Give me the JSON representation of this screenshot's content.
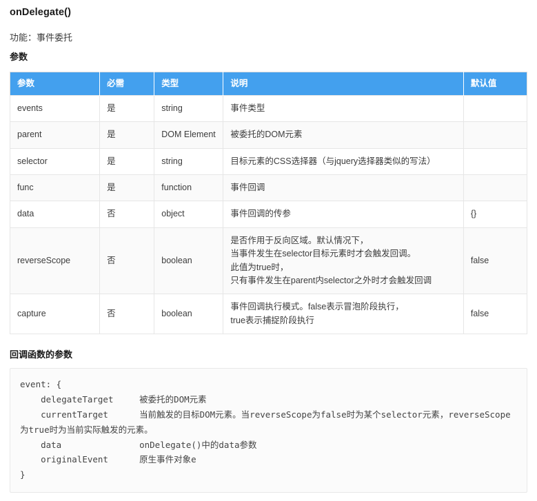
{
  "doc": {
    "title": "onDelegate()",
    "function_line": "功能：事件委托",
    "params_label": "参数",
    "callback_label": "回调函数的参数"
  },
  "table": {
    "headers": [
      "参数",
      "必需",
      "类型",
      "说明",
      "默认值"
    ],
    "rows": [
      {
        "param": "events",
        "required": "是",
        "type": "string",
        "description": "事件类型",
        "default": ""
      },
      {
        "param": "parent",
        "required": "是",
        "type": "DOM Element",
        "description": "被委托的DOM元素",
        "default": ""
      },
      {
        "param": "selector",
        "required": "是",
        "type": "string",
        "description": "目标元素的CSS选择器（与jquery选择器类似的写法）",
        "default": ""
      },
      {
        "param": "func",
        "required": "是",
        "type": "function",
        "description": "事件回调",
        "default": ""
      },
      {
        "param": "data",
        "required": "否",
        "type": "object",
        "description": "事件回调的传参",
        "default": "{}"
      },
      {
        "param": "reverseScope",
        "required": "否",
        "type": "boolean",
        "description": "是否作用于反向区域。默认情况下，\n当事件发生在selector目标元素时才会触发回调。\n此值为true时，\n只有事件发生在parent内selector之外时才会触发回调",
        "default": "false"
      },
      {
        "param": "capture",
        "required": "否",
        "type": "boolean",
        "description": "事件回调执行模式。false表示冒泡阶段执行，\ntrue表示捕捉阶段执行",
        "default": "false"
      }
    ]
  },
  "code": {
    "content": "event: {\n    delegateTarget     被委托的DOM元素\n    currentTarget      当前触发的目标DOM元素。当reverseScope为false时为某个selector元素，reverseScope为true时为当前实际触发的元素。\n    data               onDelegate()中的data参数\n    originalEvent      原生事件对象e\n}"
  },
  "colors": {
    "header_blue": "#43a0ee",
    "border_gray": "#e6e6e6",
    "code_bg": "#fbfbfb"
  }
}
